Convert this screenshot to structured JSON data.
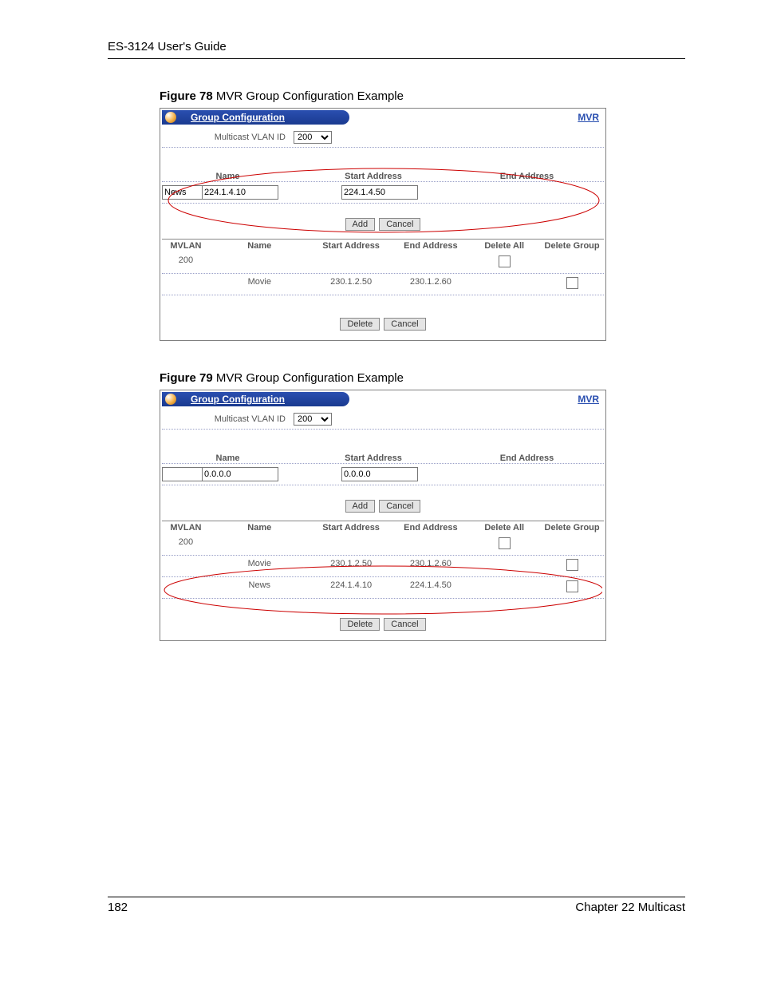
{
  "header": "ES-3124 User's Guide",
  "figA": {
    "caption_bold": "Figure 78",
    "caption_rest": "   MVR Group Configuration Example",
    "title": "Group Configuration",
    "link": "MVR",
    "mvlabel": "Multicast VLAN ID",
    "mvvalue": "200",
    "name_h": "Name",
    "start_h": "Start Address",
    "end_h": "End Address",
    "name_v": "News",
    "start_v": "224.1.4.10",
    "end_v": "224.1.4.50",
    "btn_add": "Add",
    "btn_cancel": "Cancel",
    "th": {
      "a": "MVLAN",
      "b": "Name",
      "c": "Start Address",
      "d": "End Address",
      "e": "Delete All",
      "f": "Delete Group"
    },
    "r1": {
      "a": "200",
      "b": "",
      "c": "",
      "d": ""
    },
    "r2": {
      "a": "",
      "b": "Movie",
      "c": "230.1.2.50",
      "d": "230.1.2.60"
    },
    "btn_delete": "Delete"
  },
  "figB": {
    "caption_bold": "Figure 79",
    "caption_rest": "   MVR Group Configuration Example",
    "title": "Group Configuration",
    "link": "MVR",
    "mvlabel": "Multicast VLAN ID",
    "mvvalue": "200",
    "name_h": "Name",
    "start_h": "Start Address",
    "end_h": "End Address",
    "name_v": "",
    "start_v": "0.0.0.0",
    "end_v": "0.0.0.0",
    "btn_add": "Add",
    "btn_cancel": "Cancel",
    "th": {
      "a": "MVLAN",
      "b": "Name",
      "c": "Start Address",
      "d": "End Address",
      "e": "Delete All",
      "f": "Delete Group"
    },
    "r1": {
      "a": "200",
      "b": "",
      "c": "",
      "d": ""
    },
    "r2": {
      "a": "",
      "b": "Movie",
      "c": "230.1.2.50",
      "d": "230.1.2.60"
    },
    "r3": {
      "a": "",
      "b": "News",
      "c": "224.1.4.10",
      "d": "224.1.4.50"
    },
    "btn_delete": "Delete"
  },
  "footer": {
    "page": "182",
    "chapter": "Chapter 22 Multicast"
  }
}
